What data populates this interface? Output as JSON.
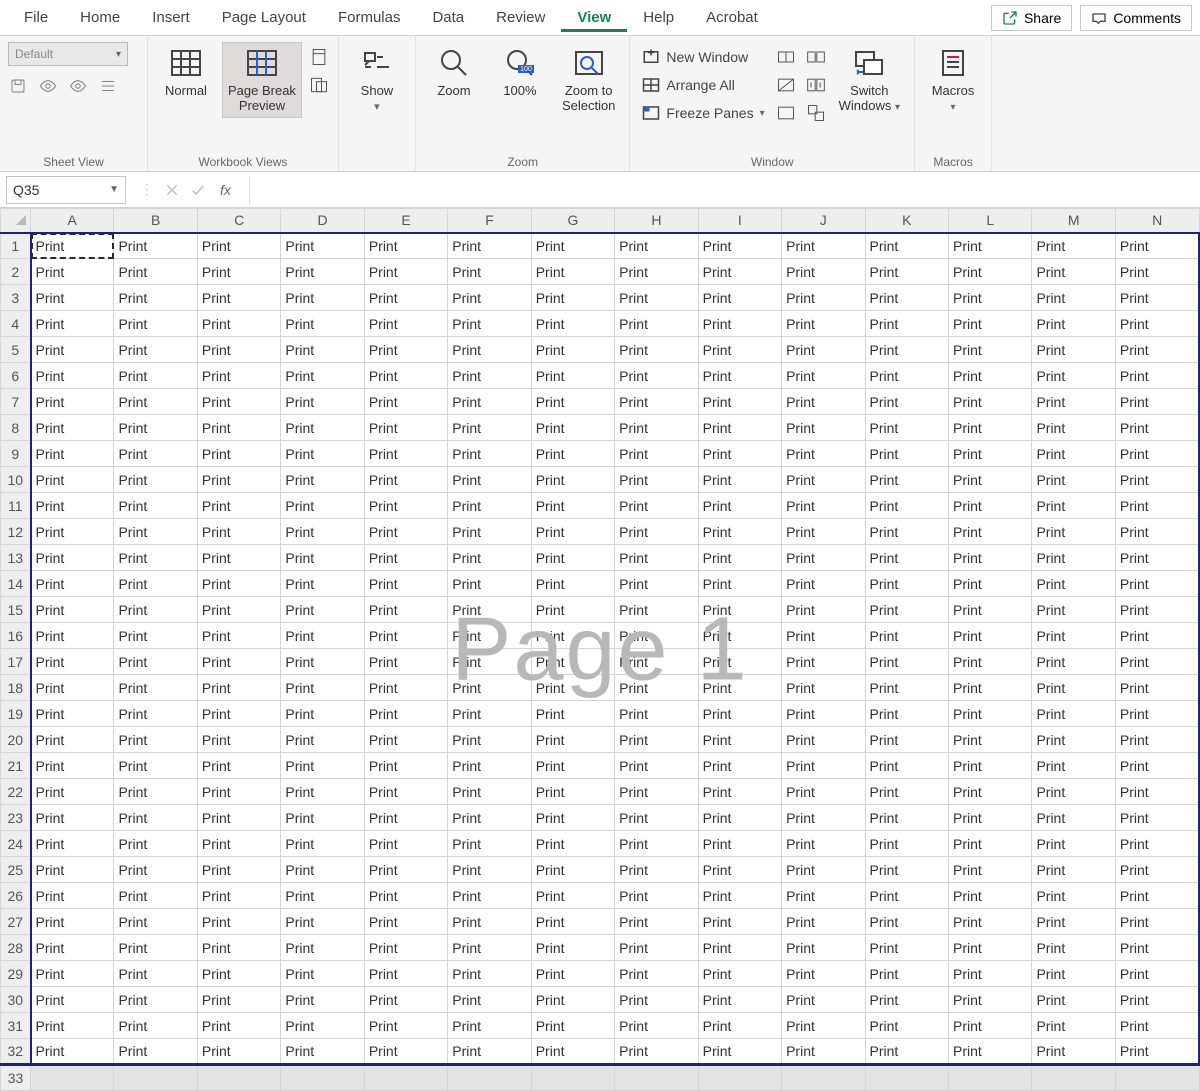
{
  "tabs": [
    "File",
    "Home",
    "Insert",
    "Page Layout",
    "Formulas",
    "Data",
    "Review",
    "View",
    "Help",
    "Acrobat"
  ],
  "active_tab": "View",
  "share_label": "Share",
  "comments_label": "Comments",
  "ribbon": {
    "sheet_view": {
      "label": "Sheet View",
      "dropdown_value": "Default"
    },
    "workbook_views": {
      "label": "Workbook Views",
      "normal": "Normal",
      "page_break": "Page Break\nPreview",
      "active": "page_break"
    },
    "show": {
      "label": "Show",
      "btn": "Show"
    },
    "zoom": {
      "label": "Zoom",
      "zoom": "Zoom",
      "hundred": "100%",
      "zoom_sel": "Zoom to\nSelection"
    },
    "window": {
      "label": "Window",
      "new_window": "New Window",
      "arrange_all": "Arrange All",
      "freeze_panes": "Freeze Panes",
      "switch": "Switch\nWindows"
    },
    "macros": {
      "label": "Macros",
      "btn": "Macros"
    }
  },
  "namebox": "Q35",
  "fx_label": "fx",
  "formula_value": "",
  "columns": [
    "A",
    "B",
    "C",
    "D",
    "E",
    "F",
    "G",
    "H",
    "I",
    "J",
    "K",
    "L",
    "M",
    "N"
  ],
  "row_count": 32,
  "extra_row": 33,
  "cell_value": "Print",
  "page_watermark": "Page 1",
  "active_cell": {
    "row": 1,
    "col": "A"
  }
}
